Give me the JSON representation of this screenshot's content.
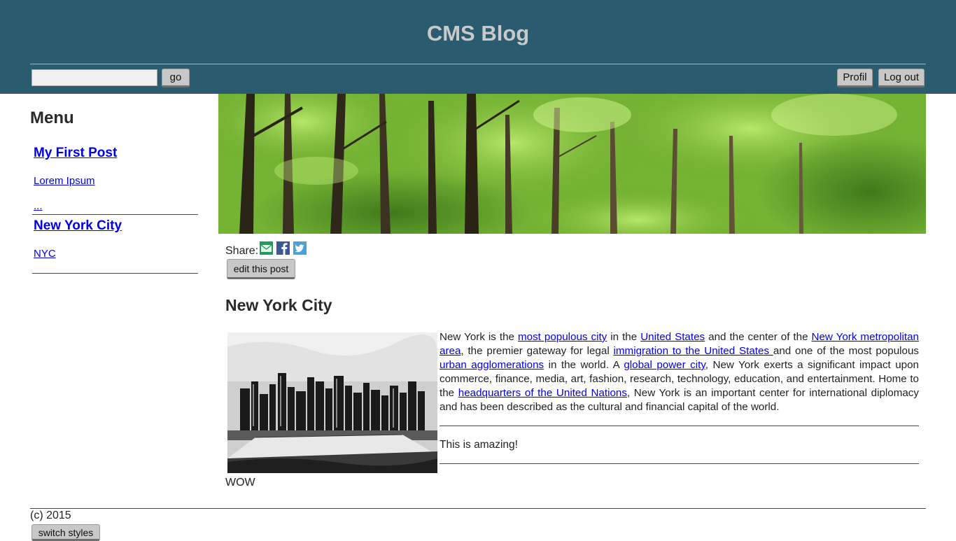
{
  "header": {
    "site_title": "CMS Blog",
    "search": {
      "value": "",
      "placeholder": ""
    },
    "go_label": "go",
    "profil_label": "Profil",
    "logout_label": "Log out"
  },
  "sidebar": {
    "title": "Menu",
    "posts": [
      {
        "title": "My First Post",
        "items": [
          "Lorem Ipsum",
          "..."
        ]
      },
      {
        "title": "New York City",
        "items": [
          "NYC"
        ]
      }
    ]
  },
  "share": {
    "label": "Share:",
    "icons": [
      "email-icon",
      "facebook-icon",
      "twitter-icon"
    ]
  },
  "edit_label": "edit this post",
  "post": {
    "title": "New York City",
    "body": {
      "t1": "New York is the ",
      "l1": "most populous city",
      "t2": " in the ",
      "l2": "United States",
      "t3": " and the center of the ",
      "l3": "New York metropolitan area",
      "t4": ", the premier gateway for legal ",
      "l4": "immigration to the United States ",
      "t5": "and one of the most populous ",
      "l5": "urban agglomerations",
      "t6": " in the world. A ",
      "l6": "global power city",
      "t7": ", New York exerts a significant impact upon commerce, finance, media, art, fashion, research, technology, education, and entertainment. Home to the ",
      "l7": "headquarters of the United Nations",
      "t8": ", New York is an important center for international diplomacy and has been described as the cultural and financial capital of the world."
    },
    "quote": "This is amazing!",
    "after": "WOW"
  },
  "footer": {
    "copyright": "(c) 2015",
    "switch_label": "switch styles"
  },
  "colors": {
    "header_bg": "#2b5b6e",
    "title_color": "#c9c9c9",
    "link": "#0000ee",
    "button_bg": "#c8c8c8"
  }
}
